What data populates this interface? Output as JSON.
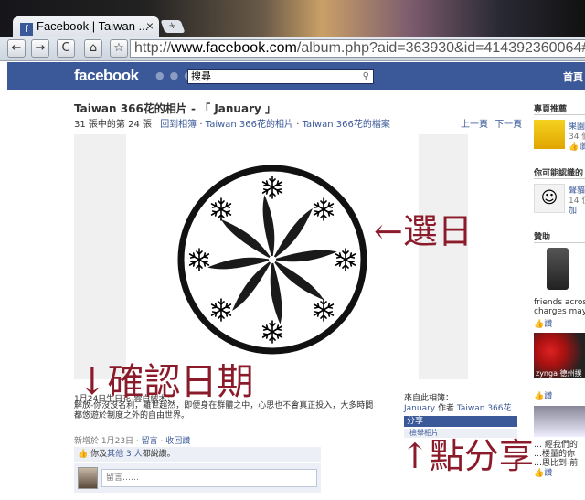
{
  "browser": {
    "tab_title": "Facebook | Taiwan ...",
    "tab_close": "×",
    "new_tab": "+",
    "url_scheme": "http://",
    "url_host": "www.facebook.com",
    "url_path": "/album.php?aid=363930&id=414392360064#!",
    "back": "←",
    "forward": "→",
    "reload": "C",
    "home": "⌂",
    "star": "☆"
  },
  "fb_header": {
    "logo": "facebook",
    "search_value": "搜尋",
    "home_link": "首頁"
  },
  "album": {
    "title": "Taiwan 366花的相片 - 「 January 」",
    "counter": "31 張中的第 24 張",
    "back_link": "回到相簿",
    "crumb_1": "Taiwan 366花的相片",
    "crumb_2": "Taiwan 366花的檔案",
    "sep": " · ",
    "prev": "上一頁",
    "next": "下一頁"
  },
  "caption": {
    "date_line": "1月24日生日花-雲白絨木：",
    "text": "解放-你沒沒名利，離世超然，即便身在群體之中，心思也不會真正投入，大多時間都悠遊於制度之外的自由世界。"
  },
  "meta": {
    "added": "新增於 1月23日",
    "comment": "留言",
    "unlike": "收回讚",
    "dot": " · "
  },
  "likes": {
    "prefix": "你及",
    "others": "其他",
    "count": "3",
    "people": "人",
    "suffix": "都說讚。"
  },
  "comment_box": {
    "placeholder": "留言……"
  },
  "from": {
    "label": "來自此相簿：",
    "album": "January",
    "by": " 作者 ",
    "author": "Taiwan 366花"
  },
  "share": {
    "button": "分享",
    "sub": "檢舉相片"
  },
  "sidebar": {
    "recommend_head": "專頁推薦",
    "rec_name": "果園",
    "rec_count": "34 個",
    "rec_like": "讚",
    "may_know_head": "你可能認識的",
    "may_name": "聲貓",
    "may_count": "14 位",
    "may_add": "加",
    "sponsor_head": "贊助",
    "ad1_text_1": "friends across",
    "ad1_text_2": "charges may",
    "ad_like": "讚",
    "ad2_brand": "zynga 德州撲",
    "ad3_line_1": "… 經我們的",
    "ad3_line_2": "…楼量的你",
    "ad3_line_3": "…思比到-前"
  },
  "annotations": {
    "select_day": "←選日",
    "confirm_date": "↓確認日期",
    "click_share": "↑點分享"
  },
  "colors": {
    "fb_blue": "#3b5998",
    "annotation": "#8b1a2a"
  }
}
